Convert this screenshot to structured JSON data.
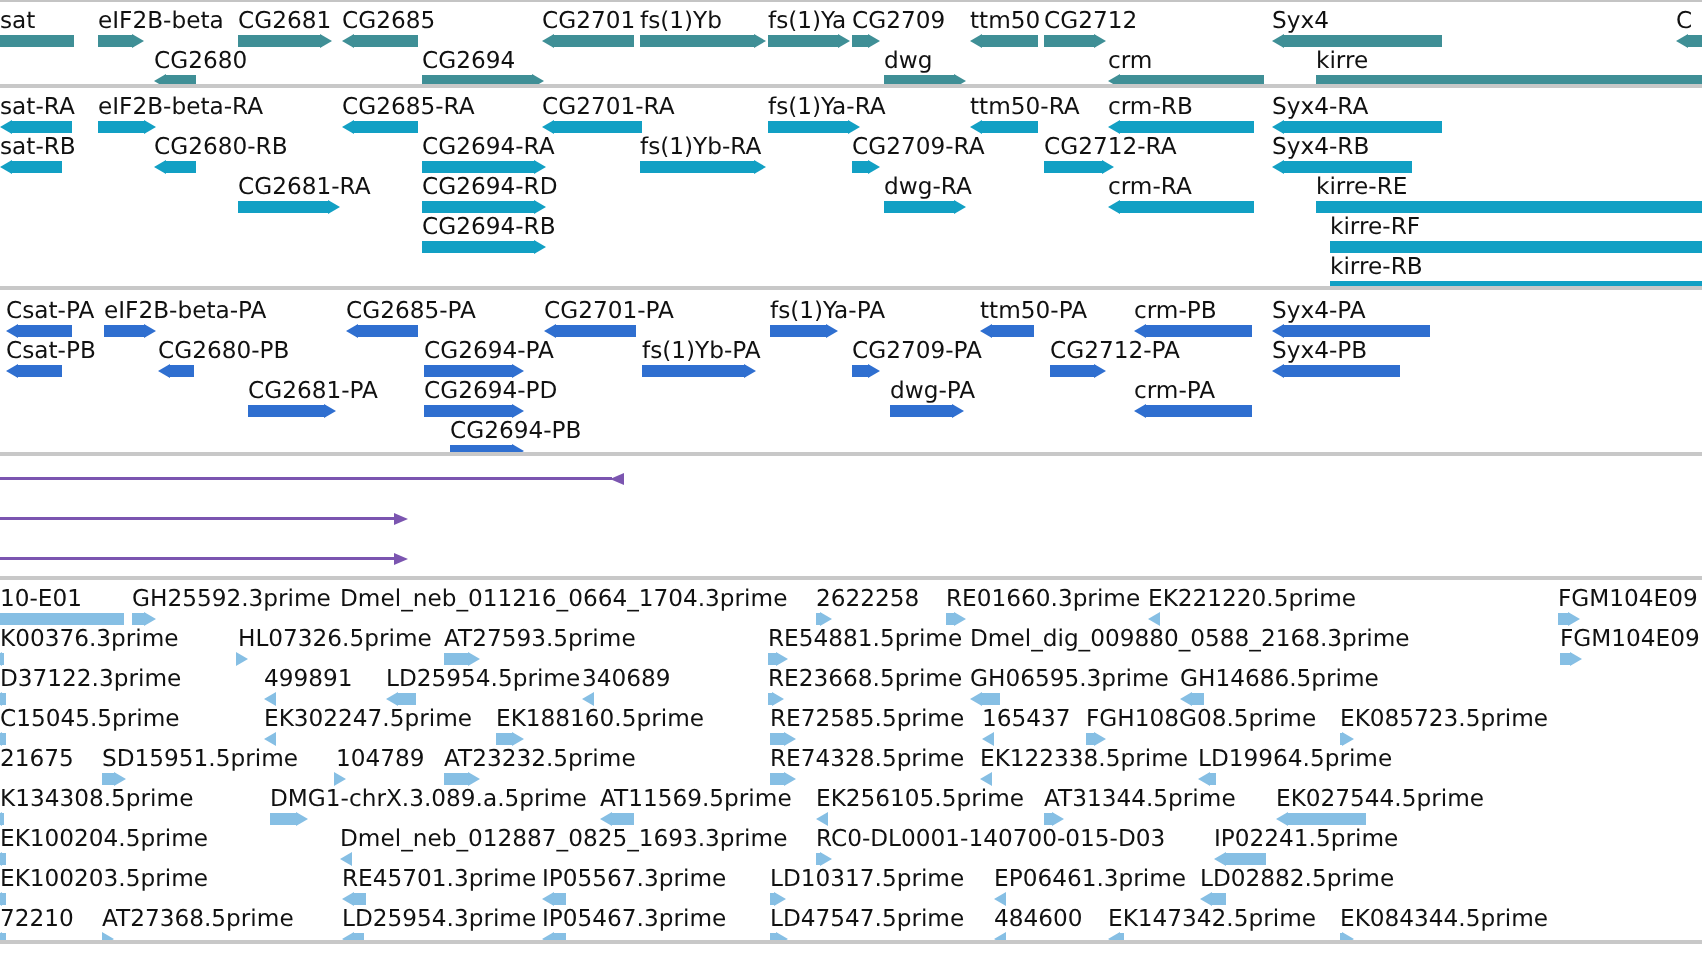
{
  "tracks": [
    {
      "kind": "gene",
      "features": [
        {
          "label": "sat",
          "reverse": true
        },
        {
          "label": "eIF2B-beta",
          "reverse": false
        },
        {
          "label": "CG2681",
          "reverse": false
        },
        {
          "label": "CG2685",
          "reverse": true
        },
        {
          "label": "CG2701",
          "reverse": true
        },
        {
          "label": "fs(1)Yb",
          "reverse": false
        },
        {
          "label": "fs(1)Ya",
          "reverse": false
        },
        {
          "label": "CG2709",
          "reverse": false
        },
        {
          "label": "ttm50",
          "reverse": true
        },
        {
          "label": "CG2712",
          "reverse": false
        },
        {
          "label": "Syx4",
          "reverse": true
        },
        {
          "label": "C",
          "reverse": true
        },
        {
          "label": "CG2680",
          "reverse": true
        },
        {
          "label": "CG2694",
          "reverse": false
        },
        {
          "label": "dwg",
          "reverse": false
        },
        {
          "label": "crm",
          "reverse": true
        },
        {
          "label": "kirre",
          "reverse": false
        }
      ]
    },
    {
      "kind": "transcript",
      "features": [
        {
          "label": "sat-RA",
          "reverse": true
        },
        {
          "label": "eIF2B-beta-RA",
          "reverse": false
        },
        {
          "label": "CG2685-RA",
          "reverse": true
        },
        {
          "label": "CG2701-RA",
          "reverse": true
        },
        {
          "label": "fs(1)Ya-RA",
          "reverse": false
        },
        {
          "label": "ttm50-RA",
          "reverse": true
        },
        {
          "label": "crm-RB",
          "reverse": true
        },
        {
          "label": "Syx4-RA",
          "reverse": true
        },
        {
          "label": "sat-RB",
          "reverse": true
        },
        {
          "label": "CG2680-RB",
          "reverse": true
        },
        {
          "label": "CG2694-RA",
          "reverse": false
        },
        {
          "label": "fs(1)Yb-RA",
          "reverse": false
        },
        {
          "label": "CG2709-RA",
          "reverse": false
        },
        {
          "label": "CG2712-RA",
          "reverse": false
        },
        {
          "label": "Syx4-RB",
          "reverse": true
        },
        {
          "label": "CG2681-RA",
          "reverse": false
        },
        {
          "label": "CG2694-RD",
          "reverse": false
        },
        {
          "label": "dwg-RA",
          "reverse": false
        },
        {
          "label": "crm-RA",
          "reverse": true
        },
        {
          "label": "kirre-RE",
          "reverse": false
        },
        {
          "label": "CG2694-RB",
          "reverse": false
        },
        {
          "label": "kirre-RF",
          "reverse": false
        },
        {
          "label": "kirre-RB",
          "reverse": false
        }
      ]
    },
    {
      "kind": "protein",
      "features": [
        {
          "label": "Csat-PA",
          "reverse": true
        },
        {
          "label": "eIF2B-beta-PA",
          "reverse": false
        },
        {
          "label": "CG2685-PA",
          "reverse": true
        },
        {
          "label": "CG2701-PA",
          "reverse": true
        },
        {
          "label": "fs(1)Ya-PA",
          "reverse": false
        },
        {
          "label": "ttm50-PA",
          "reverse": true
        },
        {
          "label": "crm-PB",
          "reverse": true
        },
        {
          "label": "Syx4-PA",
          "reverse": true
        },
        {
          "label": "Csat-PB",
          "reverse": true
        },
        {
          "label": "CG2680-PB",
          "reverse": true
        },
        {
          "label": "CG2694-PA",
          "reverse": false
        },
        {
          "label": "fs(1)Yb-PA",
          "reverse": false
        },
        {
          "label": "CG2709-PA",
          "reverse": false
        },
        {
          "label": "CG2712-PA",
          "reverse": false
        },
        {
          "label": "Syx4-PB",
          "reverse": true
        },
        {
          "label": "CG2681-PA",
          "reverse": false
        },
        {
          "label": "CG2694-PD",
          "reverse": false
        },
        {
          "label": "dwg-PA",
          "reverse": false
        },
        {
          "label": "crm-PA",
          "reverse": true
        },
        {
          "label": "CG2694-PB",
          "reverse": false
        }
      ]
    },
    {
      "kind": "alignment",
      "features": [
        {
          "reverse": true
        },
        {
          "reverse": false
        },
        {
          "reverse": false
        }
      ]
    },
    {
      "kind": "est",
      "features": [
        {
          "label": "10-E01",
          "reverse": true
        },
        {
          "label": "GH25592.3prime",
          "reverse": false
        },
        {
          "label": "Dmel_neb_011216_0664_1704.3prime"
        },
        {
          "label": "2622258",
          "reverse": false
        },
        {
          "label": "RE01660.3prime",
          "reverse": false
        },
        {
          "label": "EK221220.5prime",
          "reverse": true
        },
        {
          "label": "FGM104E09",
          "reverse": false
        },
        {
          "label": "K00376.3prime",
          "reverse": true
        },
        {
          "label": "HL07326.5prime",
          "reverse": false
        },
        {
          "label": "AT27593.5prime",
          "reverse": false
        },
        {
          "label": "RE54881.5prime",
          "reverse": false
        },
        {
          "label": "Dmel_dig_009880_0588_2168.3prime"
        },
        {
          "label": "FGM104E09",
          "reverse": false
        },
        {
          "label": "D37122.3prime",
          "reverse": true
        },
        {
          "label": "499891",
          "reverse": true
        },
        {
          "label": "LD25954.5prime",
          "reverse": true
        },
        {
          "label": "340689",
          "reverse": true
        },
        {
          "label": "RE23668.5prime",
          "reverse": false
        },
        {
          "label": "GH06595.3prime",
          "reverse": true
        },
        {
          "label": "GH14686.5prime",
          "reverse": true
        },
        {
          "label": "C15045.5prime",
          "reverse": true
        },
        {
          "label": "EK302247.5prime",
          "reverse": true
        },
        {
          "label": "EK188160.5prime",
          "reverse": false
        },
        {
          "label": "RE72585.5prime",
          "reverse": false
        },
        {
          "label": "165437",
          "reverse": true
        },
        {
          "label": "FGH108G08.5prime",
          "reverse": false
        },
        {
          "label": "EK085723.5prime",
          "reverse": false
        },
        {
          "label": "21675"
        },
        {
          "label": "SD15951.5prime",
          "reverse": false
        },
        {
          "label": "104789",
          "reverse": false
        },
        {
          "label": "AT23232.5prime",
          "reverse": false
        },
        {
          "label": "RE74328.5prime",
          "reverse": false
        },
        {
          "label": "EK122338.5prime",
          "reverse": true
        },
        {
          "label": "LD19964.5prime",
          "reverse": true
        },
        {
          "label": "K134308.5prime",
          "reverse": true
        },
        {
          "label": "DMG1-chrX.3.089.a.5prime",
          "reverse": false
        },
        {
          "label": "AT11569.5prime",
          "reverse": true
        },
        {
          "label": "EK256105.5prime",
          "reverse": true
        },
        {
          "label": "AT31344.5prime",
          "reverse": false
        },
        {
          "label": "EK027544.5prime",
          "reverse": true
        },
        {
          "label": "EK100204.5prime",
          "reverse": true
        },
        {
          "label": "Dmel_neb_012887_0825_1693.3prime",
          "reverse": true
        },
        {
          "label": "RC0-DL0001-140700-015-D03",
          "reverse": false
        },
        {
          "label": "IP02241.5prime",
          "reverse": true
        },
        {
          "label": "EK100203.5prime",
          "reverse": true
        },
        {
          "label": "RE45701.3prime",
          "reverse": true
        },
        {
          "label": "IP05567.3prime",
          "reverse": true
        },
        {
          "label": "LD10317.5prime",
          "reverse": false
        },
        {
          "label": "EP06461.3prime",
          "reverse": true
        },
        {
          "label": "LD02882.5prime",
          "reverse": true
        },
        {
          "label": "72210",
          "reverse": true
        },
        {
          "label": "AT27368.5prime",
          "reverse": false
        },
        {
          "label": "LD25954.3prime",
          "reverse": true
        },
        {
          "label": "IP05467.3prime",
          "reverse": true
        },
        {
          "label": "LD47547.5prime",
          "reverse": false
        },
        {
          "label": "484600",
          "reverse": true
        },
        {
          "label": "EK147342.5prime",
          "reverse": true
        },
        {
          "label": "EK084344.5prime",
          "reverse": false
        }
      ]
    }
  ]
}
